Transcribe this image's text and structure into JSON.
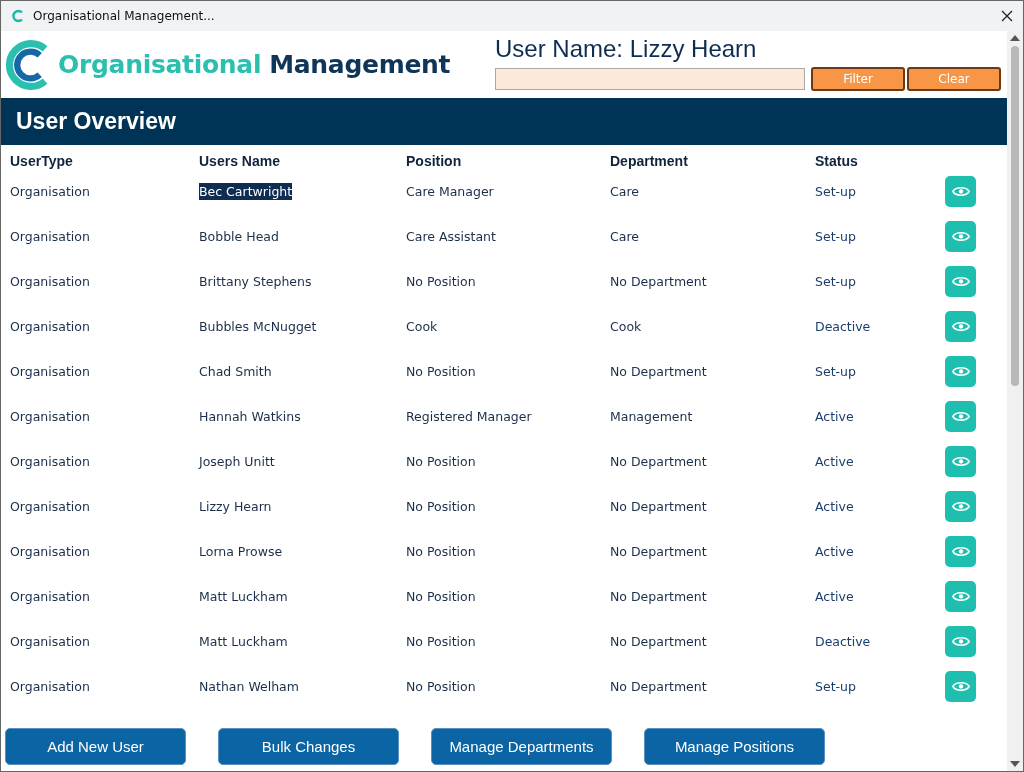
{
  "window": {
    "title": "Organisational Management..."
  },
  "header": {
    "logo_text_1": "Organisational",
    "logo_text_2": "Management",
    "user_label": "User Name: Lizzy Hearn",
    "buttons": [
      "Filter",
      "Clear"
    ]
  },
  "banner": {
    "title": "User Overview"
  },
  "table": {
    "columns": [
      "UserType",
      "Users Name",
      "Position",
      "Department",
      "Status"
    ],
    "rows": [
      {
        "user_type": "Organisation",
        "name": "Bec Cartwright",
        "name_highlighted": true,
        "position": "Care Manager",
        "department": "Care",
        "status": "Set-up"
      },
      {
        "user_type": "Organisation",
        "name": "Bobble Head",
        "name_highlighted": false,
        "position": "Care Assistant",
        "department": "Care",
        "status": "Set-up"
      },
      {
        "user_type": "Organisation",
        "name": "Brittany Stephens",
        "name_highlighted": false,
        "position": "No Position",
        "department": "No Department",
        "status": "Set-up"
      },
      {
        "user_type": "Organisation",
        "name": "Bubbles McNugget",
        "name_highlighted": false,
        "position": "Cook",
        "department": "Cook",
        "status": "Deactive"
      },
      {
        "user_type": "Organisation",
        "name": "Chad Smith",
        "name_highlighted": false,
        "position": "No Position",
        "department": "No Department",
        "status": "Set-up"
      },
      {
        "user_type": "Organisation",
        "name": "Hannah Watkins",
        "name_highlighted": false,
        "position": "Registered Manager",
        "department": "Management",
        "status": "Active"
      },
      {
        "user_type": "Organisation",
        "name": "Joseph Unitt",
        "name_highlighted": false,
        "position": "No Position",
        "department": "No Department",
        "status": "Active"
      },
      {
        "user_type": "Organisation",
        "name": "Lizzy Hearn",
        "name_highlighted": false,
        "position": "No Position",
        "department": "No Department",
        "status": "Active"
      },
      {
        "user_type": "Organisation",
        "name": "Lorna Prowse",
        "name_highlighted": false,
        "position": "No Position",
        "department": "No Department",
        "status": "Active"
      },
      {
        "user_type": "Organisation",
        "name": "Matt Luckham",
        "name_highlighted": false,
        "position": "No Position",
        "department": "No Department",
        "status": "Active"
      },
      {
        "user_type": "Organisation",
        "name": "Matt Luckham",
        "name_highlighted": false,
        "position": "No Position",
        "department": "No Department",
        "status": "Deactive"
      },
      {
        "user_type": "Organisation",
        "name": "Nathan Welham",
        "name_highlighted": false,
        "position": "No Position",
        "department": "No Department",
        "status": "Set-up"
      }
    ]
  },
  "footer_buttons": [
    "Add New User",
    "Bulk Changes",
    "Manage Departments",
    "Manage Positions"
  ]
}
